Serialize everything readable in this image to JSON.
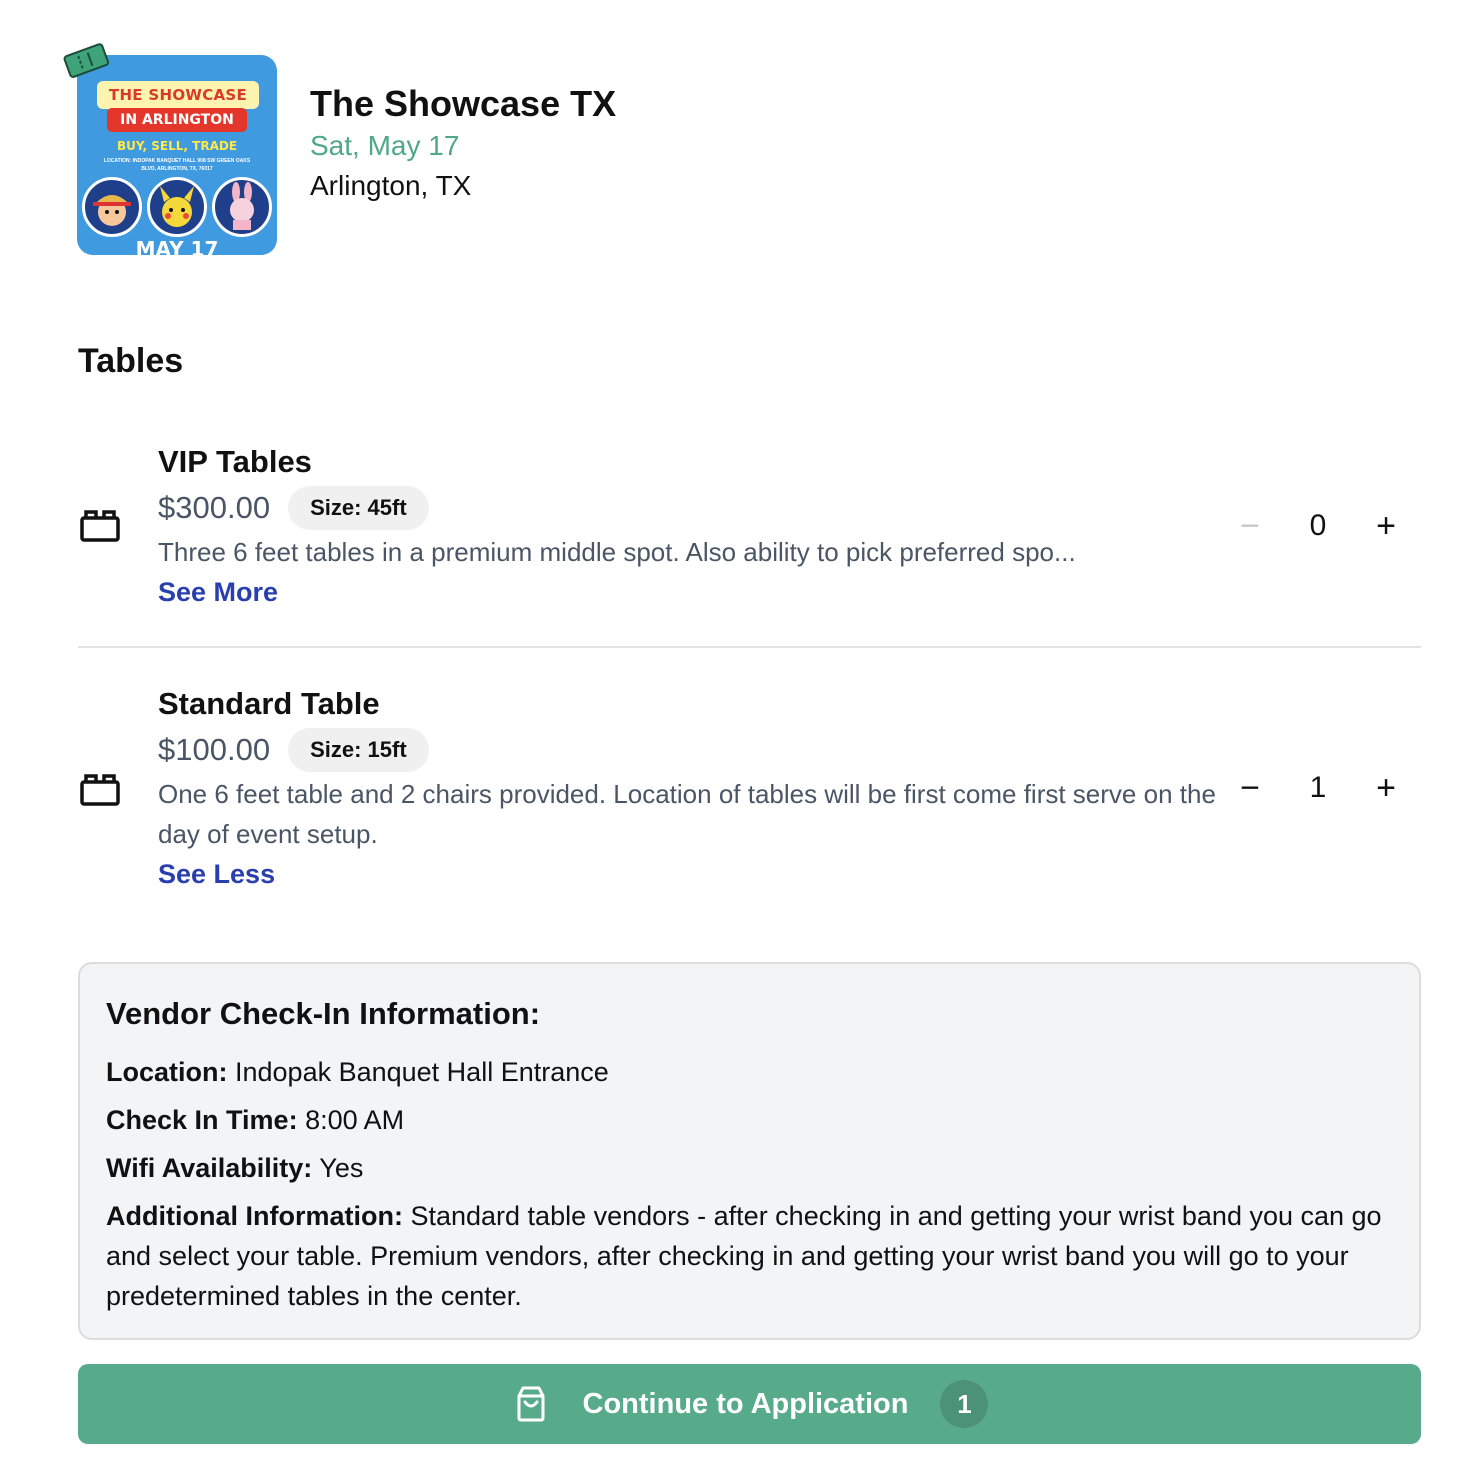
{
  "event": {
    "title": "The Showcase TX",
    "date": "Sat, May 17",
    "location": "Arlington, TX",
    "poster": {
      "line1": "THE SHOWCASE",
      "line2": "IN ARLINGTON",
      "tagline": "BUY, SELL, TRADE",
      "small": "LOCATION: INDOPAK BANQUET HALL 908 SW GREEN OAKS BLVD, ARLINGTON, TX, 76017",
      "date": "MAY 17"
    }
  },
  "section": {
    "title": "Tables"
  },
  "tickets": [
    {
      "name": "VIP Tables",
      "price": "$300.00",
      "size": "Size: 45ft",
      "description": "Three 6 feet tables in a premium middle spot. Also ability to pick preferred spo...",
      "toggle": "See More",
      "quantity": "0",
      "minus": "−",
      "plus": "+"
    },
    {
      "name": "Standard Table",
      "price": "$100.00",
      "size": "Size: 15ft",
      "description": "One 6 feet table and 2 chairs provided. Location of tables will be first come first serve on the day of event setup.",
      "toggle": "See Less",
      "quantity": "1",
      "minus": "−",
      "plus": "+"
    }
  ],
  "checkin": {
    "title": "Vendor Check-In Information:",
    "location_label": "Location:",
    "location_value": " Indopak Banquet Hall Entrance",
    "time_label": "Check In Time:",
    "time_value": " 8:00 AM",
    "wifi_label": "Wifi Availability:",
    "wifi_value": " Yes",
    "additional_label": "Additional Information:",
    "additional_value": " Standard table vendors - after checking in and getting your wrist band you can go and select your table. Premium vendors, after checking in and getting your wrist band you will go to your predetermined tables in the center."
  },
  "cta": {
    "label": "Continue to Application",
    "count": "1"
  },
  "colors": {
    "accent_green": "#58ab8a",
    "date_green": "#4fa887",
    "link_blue": "#2a3fae"
  }
}
